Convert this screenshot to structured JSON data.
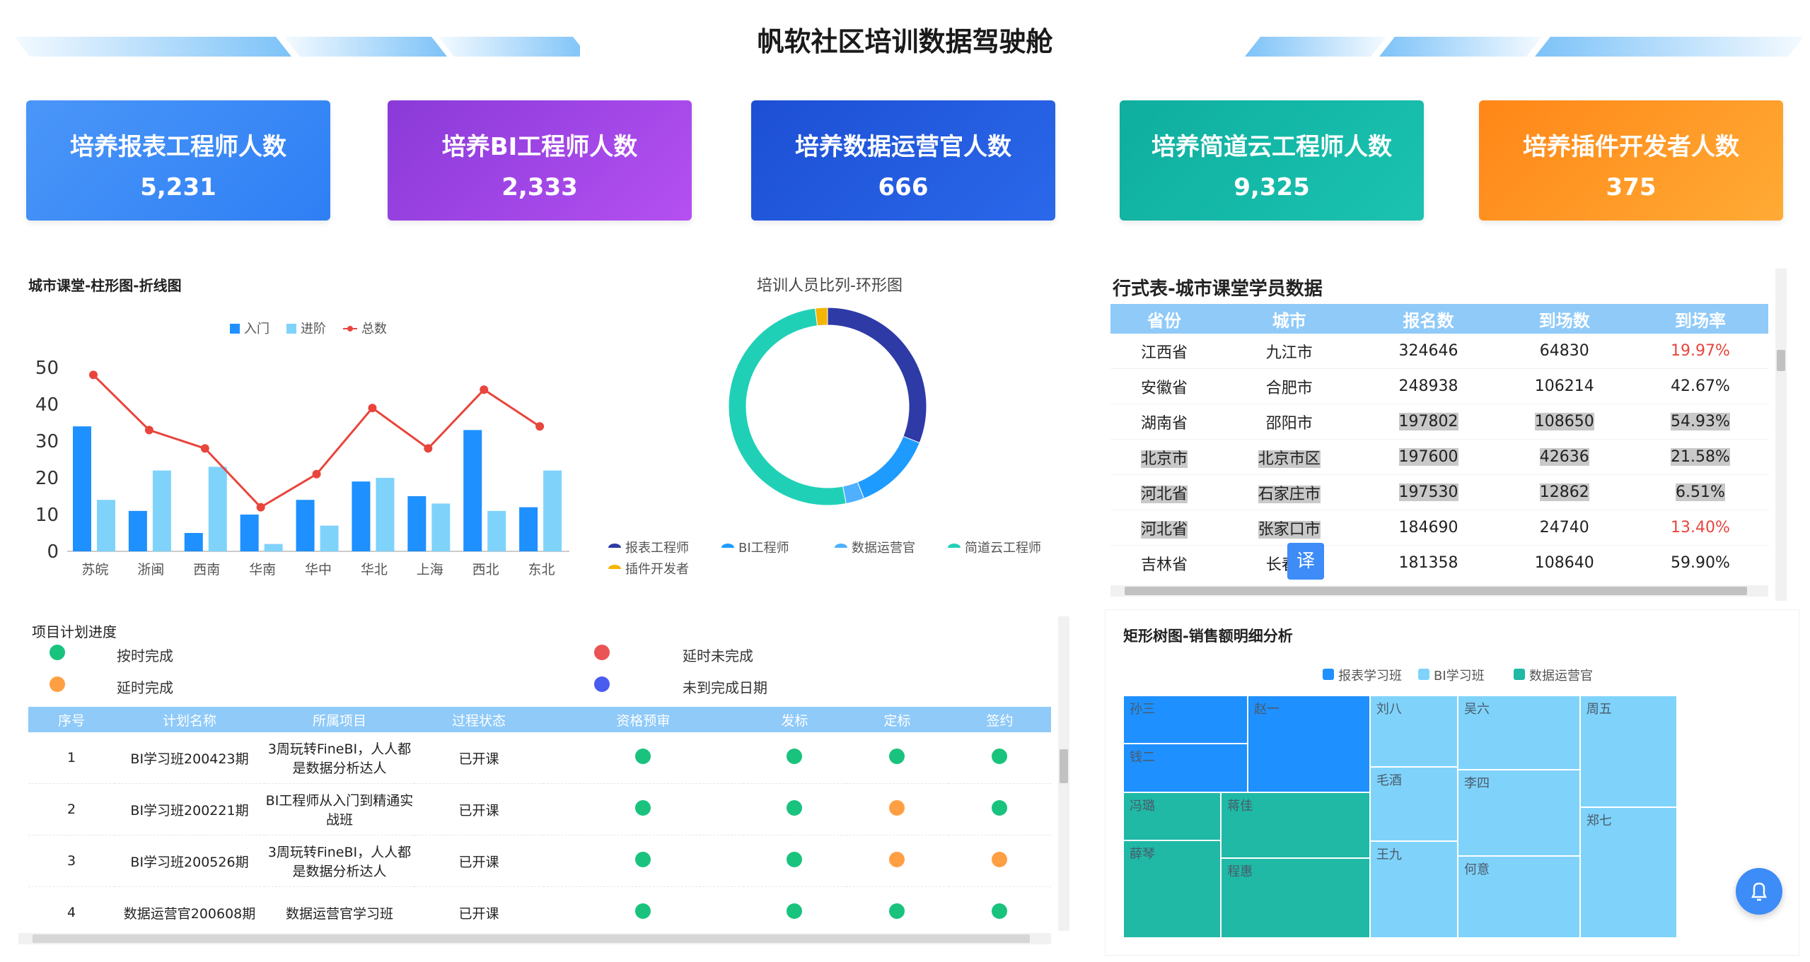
{
  "page_title": "帆软社区培训数据驾驶舱",
  "kpis": [
    {
      "label": "培养报表工程师人数",
      "value": "5,231",
      "color_start": "#3d8cf7",
      "color_end": "#2f7ff5"
    },
    {
      "label": "培养BI工程师人数",
      "value": "2,333",
      "color_start": "#8a3ad8",
      "color_end": "#b04af0"
    },
    {
      "label": "培养数据运营官人数",
      "value": "666",
      "color_start": "#1e55d8",
      "color_end": "#2a64e8"
    },
    {
      "label": "培养简道云工程师人数",
      "value": "9,325",
      "color_start": "#0fb3a3",
      "color_end": "#18c0ae"
    },
    {
      "label": "培养插件开发者人数",
      "value": "375",
      "color_start": "#ff8a1a",
      "color_end": "#ffa62e"
    }
  ],
  "bar_line_panel": {
    "title": "城市课堂-柱形图-折线图"
  },
  "donut_panel": {
    "title": "培训人员比列-环形图"
  },
  "table_panel": {
    "title": "行式表-城市课堂学员数据"
  },
  "plan_panel": {
    "title": "项目计划进度",
    "legend": [
      {
        "label": "按时完成",
        "color": "#19c37d"
      },
      {
        "label": "延时未完成",
        "color": "#ea5455"
      },
      {
        "label": "延时完成",
        "color": "#ff9f43"
      },
      {
        "label": "未到完成日期",
        "color": "#4a5cf0"
      }
    ]
  },
  "treemap_panel": {
    "title": "矩形树图-销售额明细分析"
  },
  "translate_badge": "译",
  "chart_data": [
    {
      "type": "bar",
      "title": "城市课堂-柱形图-折线图",
      "categories": [
        "苏皖",
        "浙闽",
        "西南",
        "华南",
        "华中",
        "华北",
        "上海",
        "西北",
        "东北"
      ],
      "ylim": [
        0,
        50
      ],
      "yticks": [
        0,
        10,
        20,
        30,
        40,
        50
      ],
      "legend_position": "top-center",
      "series": [
        {
          "name": "入门",
          "kind": "bar",
          "color": "#1e90ff",
          "values": [
            34,
            11,
            5,
            10,
            14,
            19,
            15,
            33,
            12
          ]
        },
        {
          "name": "进阶",
          "kind": "bar",
          "color": "#7fd3fb",
          "values": [
            14,
            22,
            23,
            2,
            7,
            20,
            13,
            11,
            22
          ]
        },
        {
          "name": "总数",
          "kind": "line",
          "color": "#e8453c",
          "values": [
            48,
            33,
            28,
            12,
            21,
            39,
            28,
            44,
            34
          ]
        }
      ]
    },
    {
      "type": "pie",
      "subtype": "donut",
      "title": "培训人员比列-环形图",
      "legend_position": "bottom",
      "slices": [
        {
          "name": "报表工程师",
          "value": 31,
          "color": "#2e3aa6"
        },
        {
          "name": "BI工程师",
          "value": 13,
          "color": "#1e9bff"
        },
        {
          "name": "数据运营官",
          "value": 3,
          "color": "#4fb0ff"
        },
        {
          "name": "简道云工程师",
          "value": 51,
          "color": "#1fd0b7"
        },
        {
          "name": "插件开发者",
          "value": 2,
          "color": "#f4b400"
        }
      ]
    },
    {
      "type": "table",
      "title": "行式表-城市课堂学员数据",
      "columns": [
        "省份",
        "城市",
        "报名数",
        "到场数",
        "到场率"
      ],
      "rows": [
        {
          "cells": [
            "江西省",
            "九江市",
            "324646",
            "64830",
            "19.97%"
          ],
          "rate_color": "#e8453c",
          "hl": [
            false,
            false,
            false,
            false,
            false
          ]
        },
        {
          "cells": [
            "安徽省",
            "合肥市",
            "248938",
            "106214",
            "42.67%"
          ],
          "rate_color": "#222222",
          "hl": [
            false,
            false,
            false,
            false,
            false
          ]
        },
        {
          "cells": [
            "湖南省",
            "邵阳市",
            "197802",
            "108650",
            "54.93%"
          ],
          "rate_color": "#222222",
          "hl": [
            false,
            false,
            true,
            true,
            true
          ]
        },
        {
          "cells": [
            "北京市",
            "北京市区",
            "197600",
            "42636",
            "21.58%"
          ],
          "rate_color": "#222222",
          "hl": [
            true,
            true,
            true,
            true,
            true
          ]
        },
        {
          "cells": [
            "河北省",
            "石家庄市",
            "197530",
            "12862",
            "6.51%"
          ],
          "rate_color": "#222222",
          "hl": [
            true,
            true,
            true,
            true,
            true
          ]
        },
        {
          "cells": [
            "河北省",
            "张家口市",
            "184690",
            "24740",
            "13.40%"
          ],
          "rate_color": "#e8453c",
          "hl": [
            true,
            true,
            false,
            false,
            false
          ]
        },
        {
          "cells": [
            "吉林省",
            "长春市",
            "181358",
            "108640",
            "59.90%"
          ],
          "rate_color": "#222222",
          "hl": [
            false,
            false,
            false,
            false,
            false
          ]
        }
      ]
    },
    {
      "type": "table",
      "title": "项目计划进度",
      "columns": [
        "序号",
        "计划名称",
        "所属项目",
        "过程状态",
        "资格预审",
        "发标",
        "定标",
        "签约"
      ],
      "rows": [
        {
          "no": "1",
          "name": "BI学习班200423期",
          "project": "3周玩转FineBI，人人都是数据分析达人",
          "state": "已开课",
          "dots": [
            "#19c37d",
            "#19c37d",
            "#19c37d",
            "#19c37d"
          ]
        },
        {
          "no": "2",
          "name": "BI学习班200221期",
          "project": "BI工程师从入门到精通实战班",
          "state": "已开课",
          "dots": [
            "#19c37d",
            "#19c37d",
            "#ff9f43",
            "#19c37d"
          ]
        },
        {
          "no": "3",
          "name": "BI学习班200526期",
          "project": "3周玩转FineBI，人人都是数据分析达人",
          "state": "已开课",
          "dots": [
            "#19c37d",
            "#19c37d",
            "#ff9f43",
            "#ff9f43"
          ]
        },
        {
          "no": "4",
          "name": "数据运营官200608期",
          "project": "数据运营官学习班",
          "state": "已开课",
          "dots": [
            "#19c37d",
            "#19c37d",
            "#19c37d",
            "#19c37d"
          ]
        }
      ]
    },
    {
      "type": "treemap",
      "title": "矩形树图-销售额明细分析",
      "legend_position": "top-center",
      "groups": [
        {
          "name": "报表学习班",
          "color": "#1e90ff",
          "items": [
            {
              "name": "孙三",
              "value": 8.2
            },
            {
              "name": "钱二",
              "value": 8.2
            },
            {
              "name": "赵一",
              "value": 20.5
            }
          ]
        },
        {
          "name": "BI学习班",
          "color": "#7fd3fb",
          "items": [
            {
              "name": "刘八",
              "value": 9.8
            },
            {
              "name": "毛酒",
              "value": 10.1
            },
            {
              "name": "王九",
              "value": 13.6
            },
            {
              "name": "吴六",
              "value": 13.7
            },
            {
              "name": "李四",
              "value": 16.3
            },
            {
              "name": "何意",
              "value": 16.0
            },
            {
              "name": "周五",
              "value": 15.3
            },
            {
              "name": "郑七",
              "value": 18.6
            }
          ]
        },
        {
          "name": "数据运营官",
          "color": "#1fb9a5",
          "items": [
            {
              "name": "冯璐",
              "value": 9.7
            },
            {
              "name": "蒋佳",
              "value": 14.7
            },
            {
              "name": "薛琴",
              "value": 15.5
            },
            {
              "name": "程惠",
              "value": 16.7
            }
          ]
        }
      ]
    }
  ]
}
